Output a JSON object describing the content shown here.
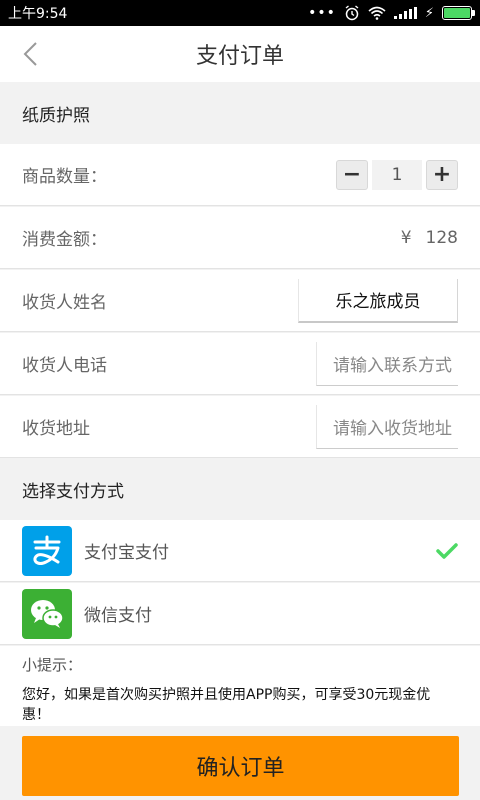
{
  "status_bar": {
    "time": "上午9:54",
    "battery_level": 1.0
  },
  "nav": {
    "title": "支付订单"
  },
  "product_section": {
    "title": "纸质护照"
  },
  "quantity": {
    "label": "商品数量：",
    "value": "1",
    "minus": "−",
    "plus": "+"
  },
  "amount": {
    "label": "消费金额：",
    "currency": "¥",
    "value": "128"
  },
  "receiver": {
    "name_label": "收货人姓名",
    "name_value": "乐之旅成员",
    "phone_label": "收货人电话",
    "phone_placeholder": "请输入联系方式",
    "address_label": "收货地址",
    "address_placeholder": "请输入收货地址"
  },
  "payment_section": {
    "title": "选择支付方式"
  },
  "payment_methods": [
    {
      "label": "支付宝支付",
      "icon": "alipay-icon",
      "color": "#00a0e9",
      "selected": true
    },
    {
      "label": "微信支付",
      "icon": "wechat-icon",
      "color": "#3cb034",
      "selected": false
    }
  ],
  "tips": {
    "title": "小提示：",
    "text": "您好，如果是首次购买护照并且使用APP购买，可享受30元现金优惠！"
  },
  "confirm_button": {
    "label": "确认订单",
    "color": "#ff9300"
  },
  "accent_check_color": "#4cd964"
}
